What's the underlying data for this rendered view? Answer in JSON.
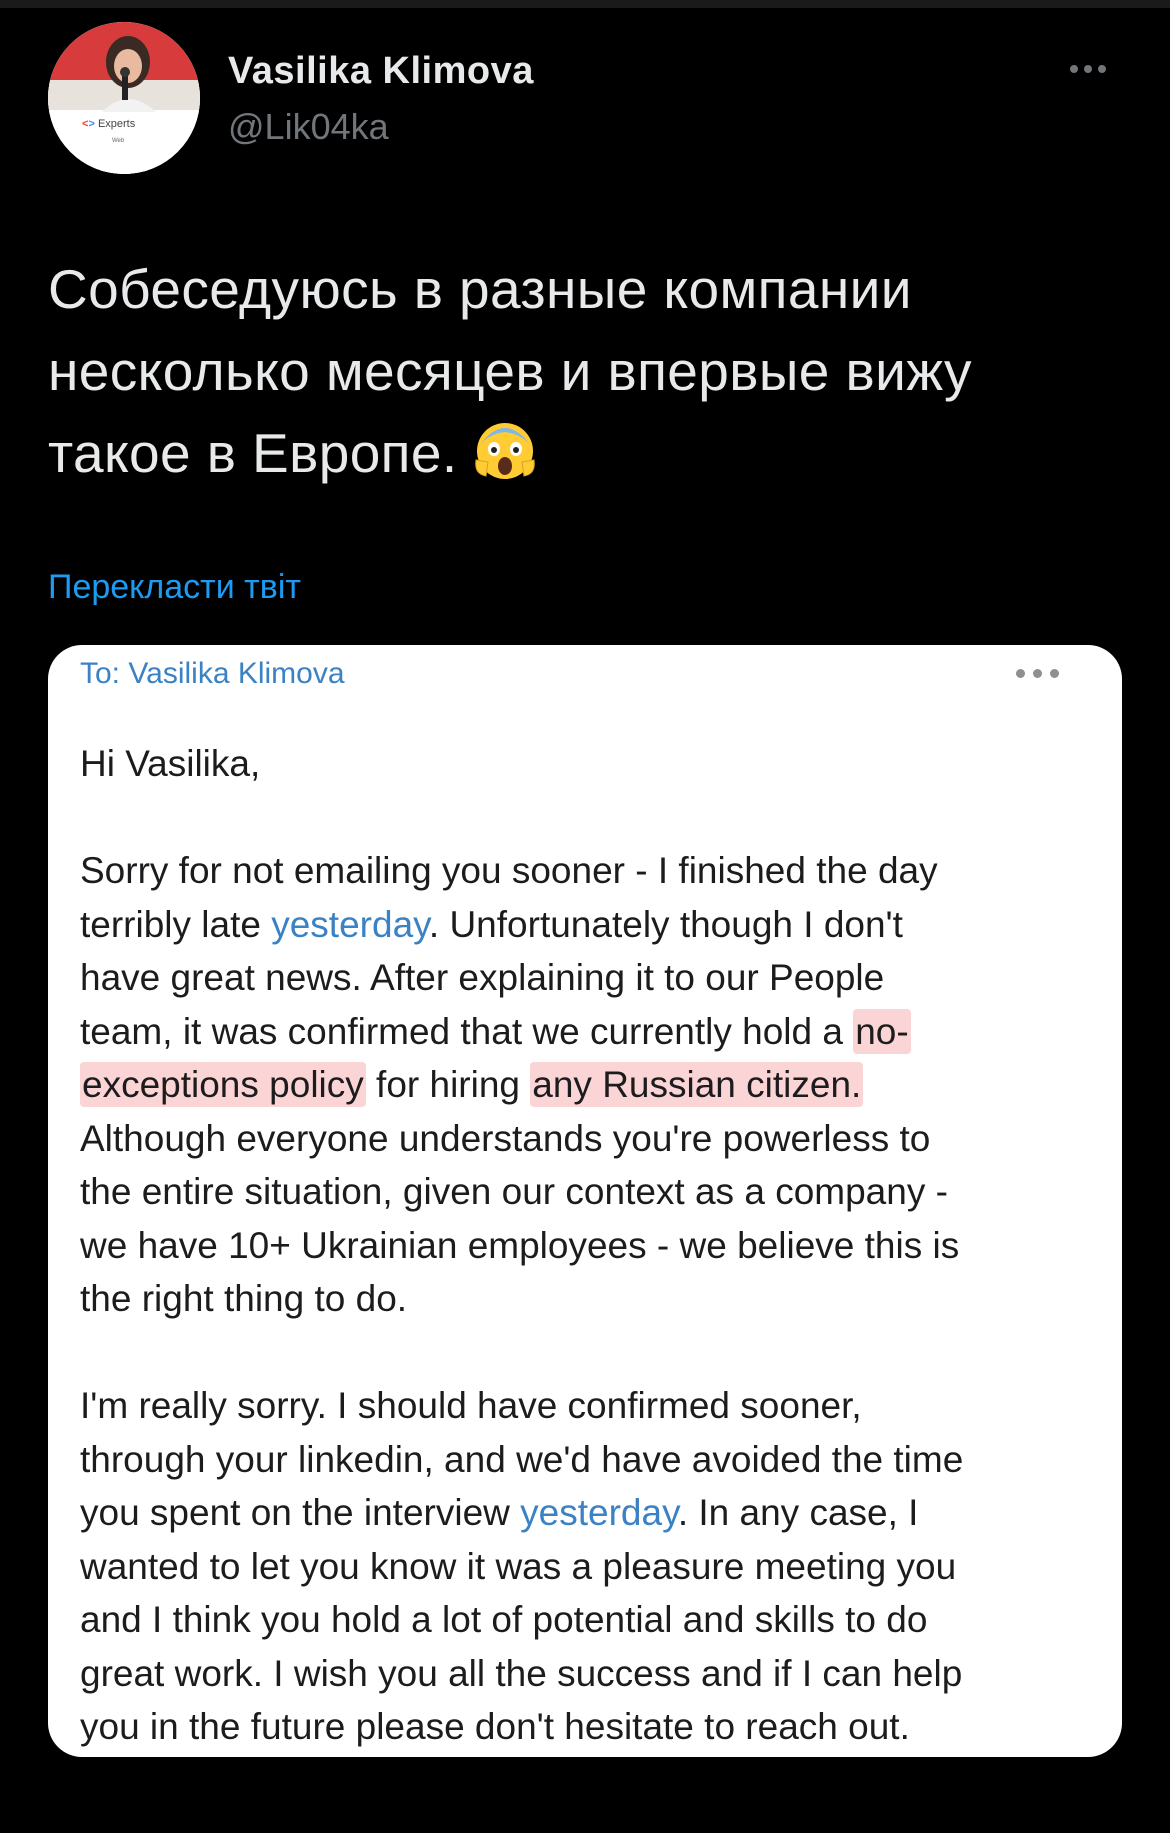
{
  "tweet": {
    "author": {
      "name": "Vasilika Klimova",
      "handle": "@Lik04ka",
      "avatar_badge_text": "Experts",
      "avatar_badge_sub": "Web"
    },
    "text_lines": [
      "Собеседуюсь в разные компании",
      "несколько месяцев и впервые вижу",
      "такое в Европе."
    ],
    "emoji": "face-screaming-in-fear",
    "translate_label": "Перекласти твіт"
  },
  "email": {
    "to_line": "To: Vasilika Klimova",
    "greeting": "Hi Vasilika,",
    "para1": {
      "l1": "Sorry for not emailing you sooner - I finished the day",
      "l2_a": "terribly late ",
      "l2_link": "yesterday",
      "l2_b": ". Unfortunately though I don't",
      "l3": "have great news. After explaining it to our People",
      "l4_a": "team, it was confirmed that we currently hold a ",
      "l4_hl": "no-",
      "l5_hl1": "exceptions policy",
      "l5_mid": " for hiring ",
      "l5_hl2": "any Russian citizen.",
      "l6": "Although everyone understands you're powerless to",
      "l7": "the entire situation, given our context as a company -",
      "l8": "we have 10+ Ukrainian employees - we believe this is",
      "l9": "the right thing to do."
    },
    "para2": {
      "l1": "I'm really sorry. I should have confirmed sooner,",
      "l2": "through your linkedin, and we'd have avoided the time",
      "l3_a": "you spent on the interview ",
      "l3_link": "yesterday",
      "l3_b": ". In any case, I",
      "l4": "wanted to let you know it was a pleasure meeting you",
      "l5": "and I think you hold a lot of potential and skills to do",
      "l6": "great work. I wish you all the success and if I can help",
      "l7": "you in the future please don't hesitate to reach out."
    }
  },
  "colors": {
    "background": "#000000",
    "link": "#1d9bf0",
    "email_link": "#3b82c4",
    "highlight": "#fbd5d5"
  }
}
